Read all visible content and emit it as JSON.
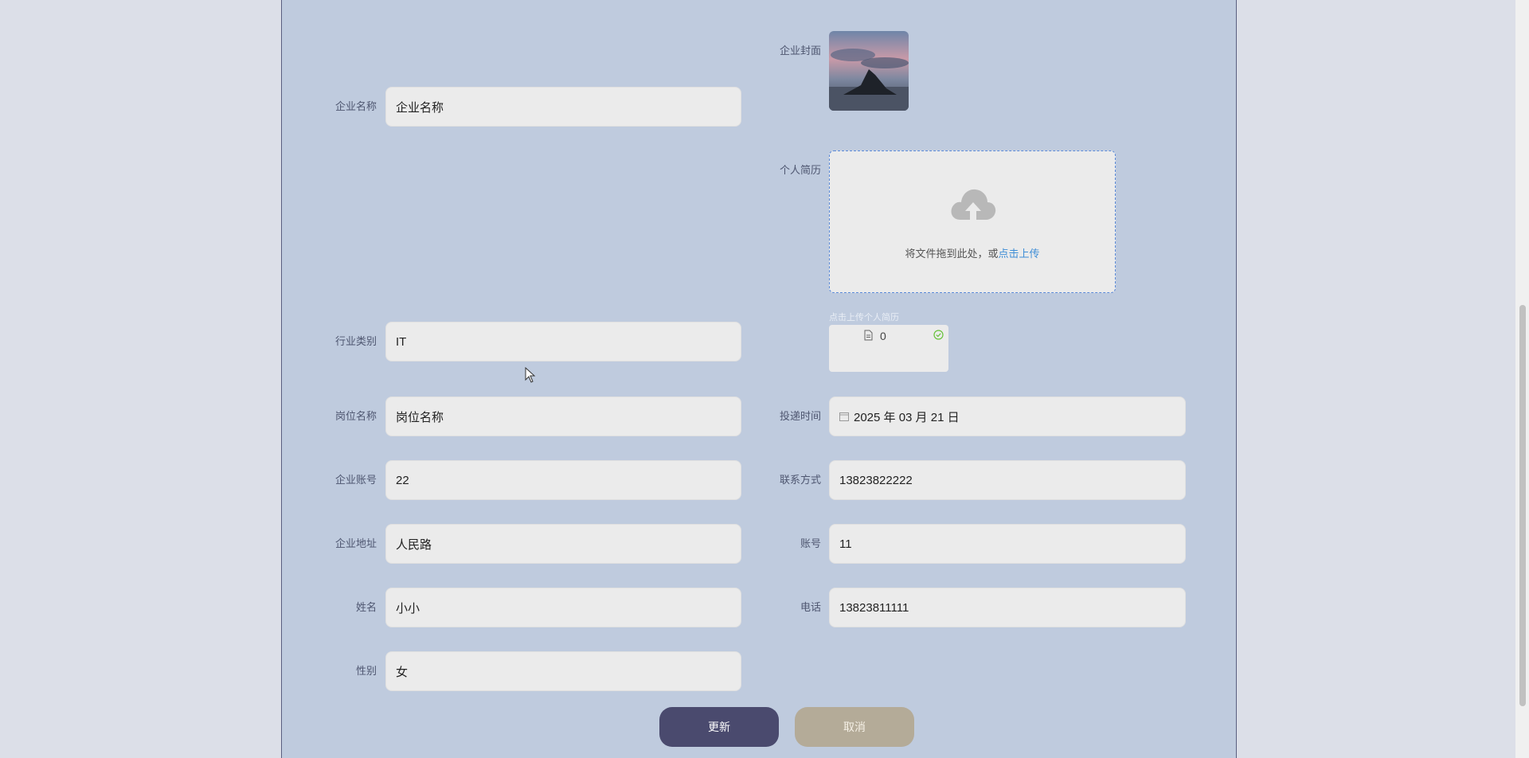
{
  "form": {
    "company_name": {
      "label": "企业名称",
      "value": "企业名称"
    },
    "company_cover": {
      "label": "企业封面"
    },
    "resume": {
      "label": "个人简历",
      "drop_text": "将文件拖到此处，或",
      "click_text": "点击上传",
      "hint": "点击上传个人简历",
      "file_name": "0"
    },
    "industry": {
      "label": "行业类别",
      "value": "IT"
    },
    "position": {
      "label": "岗位名称",
      "value": "岗位名称"
    },
    "submit_time": {
      "label": "投递时间",
      "value": "2025 年 03 月 21 日"
    },
    "company_account": {
      "label": "企业账号",
      "value": "22"
    },
    "contact": {
      "label": "联系方式",
      "value": "13823822222"
    },
    "company_address": {
      "label": "企业地址",
      "value": "人民路"
    },
    "account": {
      "label": "账号",
      "value": "11"
    },
    "name": {
      "label": "姓名",
      "value": "小小"
    },
    "phone": {
      "label": "电话",
      "value": "13823811111"
    },
    "gender": {
      "label": "性别",
      "value": "女"
    }
  },
  "buttons": {
    "update": "更新",
    "cancel": "取消"
  },
  "colors": {
    "panel_bg": "#bfcbde",
    "accent": "#4a4a6e",
    "link": "#3f8ed6"
  }
}
